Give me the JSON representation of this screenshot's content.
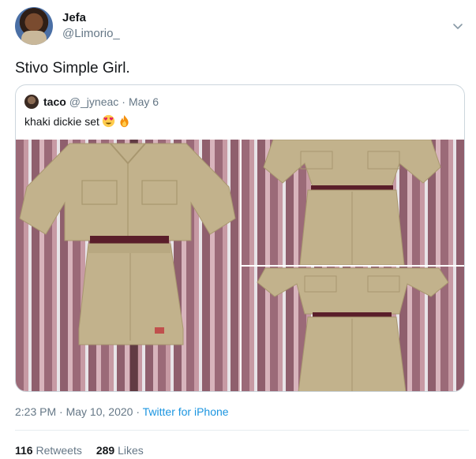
{
  "author": {
    "display_name": "Jefa",
    "handle": "@Limorio_"
  },
  "tweet": {
    "text": "Stivo Simple Girl."
  },
  "quoted": {
    "name": "taco",
    "handle": "@_jyneac",
    "separator": "·",
    "date": "May 6",
    "text": "khaki dickie set",
    "emojis": [
      "heart-eyes-emoji",
      "fire-emoji"
    ]
  },
  "meta": {
    "time": "2:23 PM",
    "dot1": "·",
    "date": "May 10, 2020",
    "dot2": "·",
    "source": "Twitter for iPhone"
  },
  "stats": {
    "retweets_count": "116",
    "retweets_label": "Retweets",
    "likes_count": "289",
    "likes_label": "Likes"
  },
  "colors": {
    "link": "#1b95e0",
    "muted": "#657786",
    "khaki": "#c2b28c"
  }
}
